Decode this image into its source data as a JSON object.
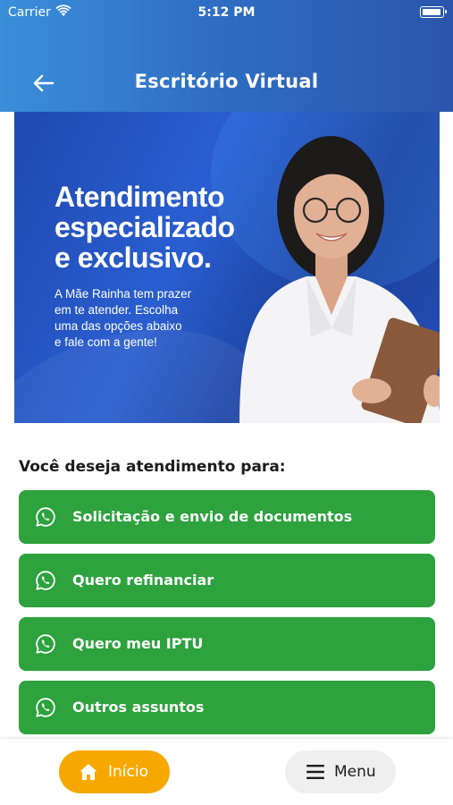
{
  "status_bar": {
    "carrier": "Carrier",
    "time": "5:12 PM"
  },
  "header": {
    "title": "Escritório Virtual"
  },
  "banner": {
    "headline_line1": "Atendimento",
    "headline_line2": "especializado",
    "headline_line3": "e exclusivo.",
    "body_line1": "A Mãe Rainha tem prazer",
    "body_line2": "em te atender. Escolha",
    "body_line3": "uma das opções abaixo",
    "body_line4": "e fale com a gente!"
  },
  "section": {
    "title": "Você deseja atendimento para:"
  },
  "options": [
    {
      "label": "Solicitação e envio de documentos",
      "icon": "whatsapp-icon"
    },
    {
      "label": "Quero refinanciar",
      "icon": "whatsapp-icon"
    },
    {
      "label": "Quero meu IPTU",
      "icon": "whatsapp-icon"
    },
    {
      "label": "Outros assuntos",
      "icon": "whatsapp-icon"
    }
  ],
  "bottom_nav": {
    "home_label": "Início",
    "menu_label": "Menu"
  },
  "colors": {
    "header_gradient_start": "#3a8fd9",
    "header_gradient_end": "#2b55ab",
    "option_button": "#2da23d",
    "home_tab": "#f6a800",
    "menu_tab": "#efefef"
  }
}
